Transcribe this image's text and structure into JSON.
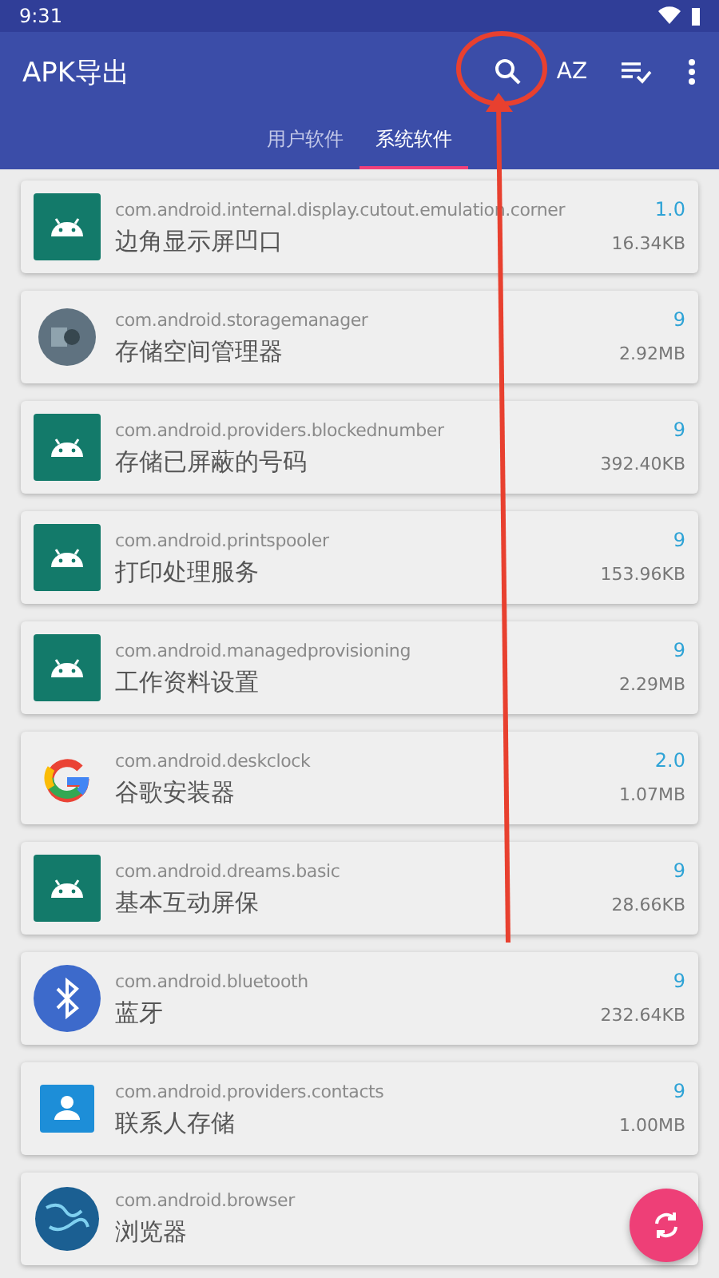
{
  "status_bar": {
    "time": "9:31"
  },
  "toolbar": {
    "title": "APK导出",
    "sort_label": "AZ"
  },
  "tabs": [
    {
      "label": "用户软件",
      "selected": false
    },
    {
      "label": "系统软件",
      "selected": true
    }
  ],
  "apps": [
    {
      "package": "com.android.internal.display.cutout.emulation.corner",
      "name": "边角显示屏凹口",
      "version": "1.0",
      "size": "16.34KB",
      "kind": "android"
    },
    {
      "package": "com.android.storagemanager",
      "name": "存储空间管理器",
      "version": "9",
      "size": "2.92MB",
      "kind": "storage"
    },
    {
      "package": "com.android.providers.blockednumber",
      "name": "存储已屏蔽的号码",
      "version": "9",
      "size": "392.40KB",
      "kind": "android"
    },
    {
      "package": "com.android.printspooler",
      "name": "打印处理服务",
      "version": "9",
      "size": "153.96KB",
      "kind": "android"
    },
    {
      "package": "com.android.managedprovisioning",
      "name": "工作资料设置",
      "version": "9",
      "size": "2.29MB",
      "kind": "android"
    },
    {
      "package": "com.android.deskclock",
      "name": "谷歌安装器",
      "version": "2.0",
      "size": "1.07MB",
      "kind": "google"
    },
    {
      "package": "com.android.dreams.basic",
      "name": "基本互动屏保",
      "version": "9",
      "size": "28.66KB",
      "kind": "android"
    },
    {
      "package": "com.android.bluetooth",
      "name": "蓝牙",
      "version": "9",
      "size": "232.64KB",
      "kind": "bluetooth"
    },
    {
      "package": "com.android.providers.contacts",
      "name": "联系人存储",
      "version": "9",
      "size": "1.00MB",
      "kind": "contacts"
    },
    {
      "package": "com.android.browser",
      "name": "浏览器",
      "kind": "browser"
    }
  ]
}
